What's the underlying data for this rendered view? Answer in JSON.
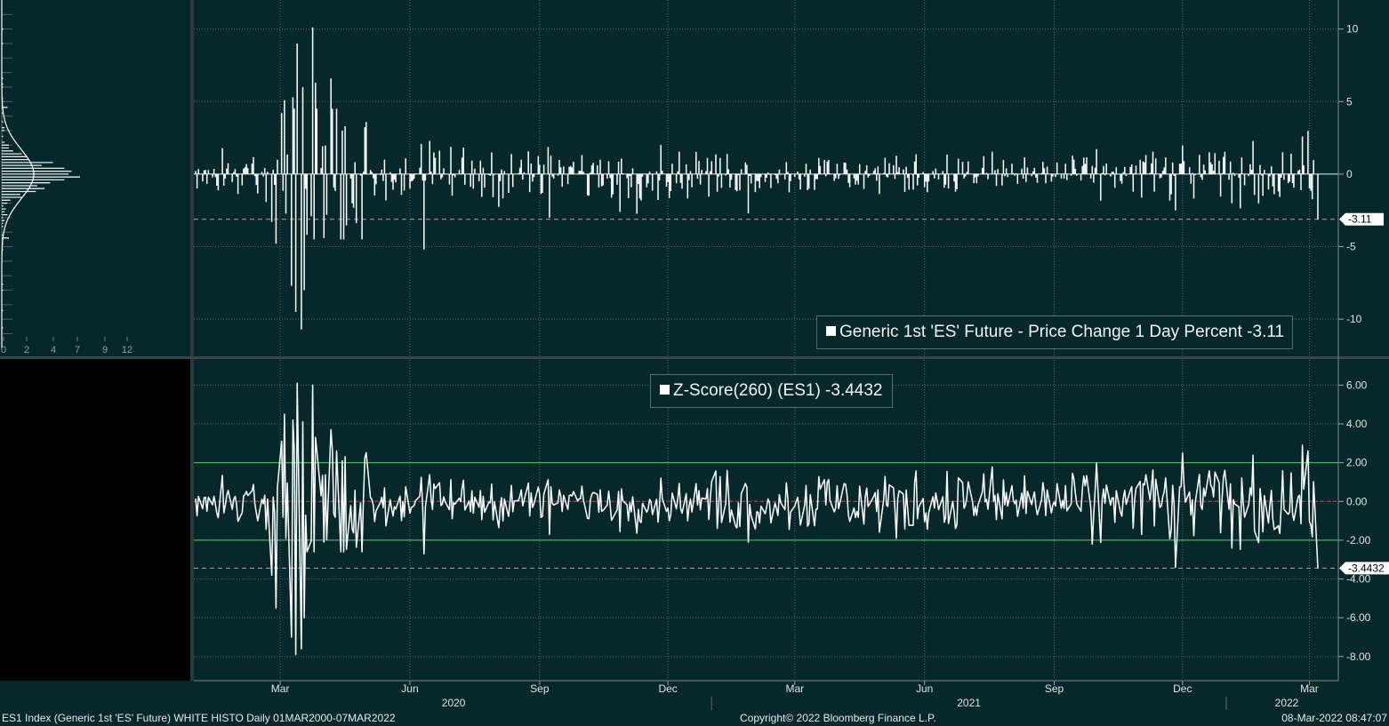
{
  "colors": {
    "background": "#06282a",
    "series": "#ffffff",
    "zero_line": "#d9453d",
    "last_value_line": "#e08aa0",
    "band_line": "#3fb45a",
    "gridline": "#4d6a6a",
    "left_panel_bottom": "#000000"
  },
  "footer": {
    "left": "ES1 Index (Generic 1st 'ES' Future) WHITE HISTO  Daily 01MAR2000-07MAR2022",
    "center": "Copyright© 2022 Bloomberg Finance L.P.",
    "right": "08-Mar-2022 08:47:07"
  },
  "x_axis": {
    "months": [
      "Mar",
      "Jun",
      "Sep",
      "Dec",
      "Mar",
      "Jun",
      "Sep",
      "Dec",
      "Mar"
    ],
    "years": [
      "2020",
      "2021",
      "2022"
    ]
  },
  "chart_data": [
    {
      "type": "bar",
      "legend": "Generic 1st 'ES' Future - Price Change 1 Day Percent -3.11",
      "last_value_label": "-3.11",
      "last_value": -3.11,
      "ylim": [
        -12.5,
        12
      ],
      "yticks": [
        10,
        5,
        0,
        -5,
        -10
      ],
      "ytick_labels": [
        "10",
        "5",
        "0",
        "-5",
        "-10"
      ],
      "x_start": "2020-01-01",
      "x_end": "2022-03-07",
      "spikes": [
        {
          "date": "2020-02-24",
          "value": -3.3
        },
        {
          "date": "2020-02-27",
          "value": -4.8
        },
        {
          "date": "2020-03-02",
          "value": 4.2
        },
        {
          "date": "2020-03-04",
          "value": 5.1
        },
        {
          "date": "2020-03-09",
          "value": -7.7
        },
        {
          "date": "2020-03-10",
          "value": 5.3
        },
        {
          "date": "2020-03-12",
          "value": -9.5
        },
        {
          "date": "2020-03-13",
          "value": 9.0
        },
        {
          "date": "2020-03-16",
          "value": -10.7
        },
        {
          "date": "2020-03-17",
          "value": 6.0
        },
        {
          "date": "2020-03-18",
          "value": -8.0
        },
        {
          "date": "2020-03-23",
          "value": -2.9
        },
        {
          "date": "2020-03-24",
          "value": 10.1
        },
        {
          "date": "2020-03-26",
          "value": 6.3
        },
        {
          "date": "2020-04-01",
          "value": -4.4
        },
        {
          "date": "2020-04-06",
          "value": 6.6
        },
        {
          "date": "2020-04-14",
          "value": 3.0
        },
        {
          "date": "2020-06-11",
          "value": -5.2
        },
        {
          "date": "2020-09-08",
          "value": -3.0
        },
        {
          "date": "2020-10-28",
          "value": -2.6
        },
        {
          "date": "2021-01-27",
          "value": -2.7
        },
        {
          "date": "2021-11-26",
          "value": -2.5
        },
        {
          "date": "2022-01-05",
          "value": -2.0
        },
        {
          "date": "2022-02-24",
          "value": 2.6
        },
        {
          "date": "2022-03-07",
          "value": -3.11
        }
      ]
    },
    {
      "type": "line",
      "legend": "Z-Score(260) (ES1) -3.4432",
      "last_value_label": "-3.4432",
      "last_value": -3.4432,
      "ylim": [
        -9.2,
        7.3
      ],
      "yticks": [
        6,
        4,
        2,
        0,
        -2,
        -4,
        -6,
        -8
      ],
      "ytick_labels": [
        "6.00",
        "4.00",
        "2.00",
        "0.00",
        "-2.00",
        "-4.00",
        "-6.00",
        "-8.00"
      ],
      "bands": [
        2,
        0,
        -2
      ],
      "x_start": "2020-01-01",
      "x_end": "2022-03-07",
      "spikes": [
        {
          "date": "2020-02-24",
          "value": -3.8
        },
        {
          "date": "2020-02-27",
          "value": -5.5
        },
        {
          "date": "2020-03-02",
          "value": 3.1
        },
        {
          "date": "2020-03-04",
          "value": 4.5
        },
        {
          "date": "2020-03-09",
          "value": -7.0
        },
        {
          "date": "2020-03-10",
          "value": 4.2
        },
        {
          "date": "2020-03-12",
          "value": -7.9
        },
        {
          "date": "2020-03-13",
          "value": 6.1
        },
        {
          "date": "2020-03-16",
          "value": -7.6
        },
        {
          "date": "2020-03-17",
          "value": 4.1
        },
        {
          "date": "2020-03-18",
          "value": -6.0
        },
        {
          "date": "2020-03-24",
          "value": 6.0
        },
        {
          "date": "2020-03-26",
          "value": 3.3
        },
        {
          "date": "2020-04-01",
          "value": -2.1
        },
        {
          "date": "2020-04-06",
          "value": 3.7
        },
        {
          "date": "2020-06-11",
          "value": -2.7
        },
        {
          "date": "2020-09-08",
          "value": -1.7
        },
        {
          "date": "2021-01-27",
          "value": -2.1
        },
        {
          "date": "2021-05-12",
          "value": -1.9
        },
        {
          "date": "2021-09-28",
          "value": -2.2
        },
        {
          "date": "2021-11-26",
          "value": -3.4
        },
        {
          "date": "2021-12-01",
          "value": 2.5
        },
        {
          "date": "2022-01-05",
          "value": -2.4
        },
        {
          "date": "2022-02-24",
          "value": 2.9
        },
        {
          "date": "2022-03-07",
          "value": -3.4432
        }
      ]
    }
  ],
  "histogram": {
    "xtick_labels": [
      "0",
      "2",
      "4",
      "7",
      "9",
      "12"
    ]
  }
}
